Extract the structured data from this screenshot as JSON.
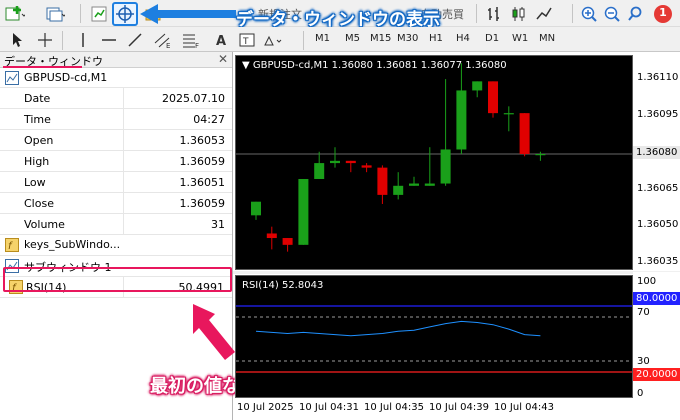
{
  "toolbar": {
    "new_order_label": "新規注文",
    "auto_trade_label": "自動売買",
    "timeframes": [
      "M1",
      "M5",
      "M15",
      "M30",
      "H1",
      "H4",
      "D1",
      "W1",
      "MN"
    ],
    "notification_count": "1"
  },
  "callout_top": "データ・ウィンドウの表示",
  "callout_bottom": "最初の値なので1番",
  "data_window": {
    "title": "データ・ウィンドウ",
    "symbol": "GBPUSD-cd,M1",
    "rows": [
      {
        "key": "Date",
        "value": "2025.07.10"
      },
      {
        "key": "Time",
        "value": "04:27"
      },
      {
        "key": "Open",
        "value": "1.36053"
      },
      {
        "key": "High",
        "value": "1.36059"
      },
      {
        "key": "Low",
        "value": "1.36051"
      },
      {
        "key": "Close",
        "value": "1.36059"
      },
      {
        "key": "Volume",
        "value": "31"
      }
    ],
    "indicator_name": "keys_SubWindo...",
    "subwindow_name": "サブウィンドウ 1",
    "rsi_key": "RSI(14)",
    "rsi_value": "50.4991"
  },
  "chart": {
    "info": "GBPUSD-cd,M1  1.36080  1.36081  1.36077  1.36080",
    "price_labels": [
      "1.36110",
      "1.36095",
      "1.36080",
      "1.36065",
      "1.36050",
      "1.36035"
    ],
    "current_price": "1.36080",
    "rsi_info": "RSI(14) 52.8043",
    "rsi_scale": [
      "100",
      "70",
      "30",
      "0"
    ],
    "rsi_level_high": "80.0000",
    "rsi_level_low": "20.0000",
    "time_labels": [
      "10 Jul 2025",
      "10 Jul 04:31",
      "10 Jul 04:35",
      "10 Jul 04:39",
      "10 Jul 04:43"
    ],
    "colors": {
      "bull": "#1aa01a",
      "bear": "#e00000",
      "rsi": "#1e90ff",
      "level_high": "#2222ff",
      "level_low": "#ff2020"
    }
  },
  "chart_data": {
    "type": "candlestick",
    "x": [
      "04:27",
      "04:28",
      "04:29",
      "04:30",
      "04:31",
      "04:32",
      "04:33",
      "04:34",
      "04:35",
      "04:36",
      "04:37",
      "04:38",
      "04:39",
      "04:40",
      "04:41",
      "04:42",
      "04:43",
      "04:44",
      "04:45"
    ],
    "open": [
      1.36053,
      1.36045,
      1.36043,
      1.3604,
      1.36069,
      1.36076,
      1.36077,
      1.36075,
      1.36074,
      1.36062,
      1.36066,
      1.36066,
      1.36067,
      1.36082,
      1.36108,
      1.36112,
      1.36098,
      1.36098,
      1.3608
    ],
    "high": [
      1.36059,
      1.36048,
      1.36043,
      1.36054,
      1.36081,
      1.36083,
      1.36077,
      1.36076,
      1.36075,
      1.36072,
      1.3607,
      1.36083,
      1.36113,
      1.3612,
      1.36112,
      1.36112,
      1.36101,
      1.36098,
      1.36081
    ],
    "low": [
      1.36051,
      1.36038,
      1.36037,
      1.3604,
      1.36069,
      1.36074,
      1.36072,
      1.36072,
      1.36058,
      1.3606,
      1.36066,
      1.36066,
      1.36066,
      1.3608,
      1.36105,
      1.36096,
      1.3609,
      1.36079,
      1.36077
    ],
    "close": [
      1.36059,
      1.36043,
      1.3604,
      1.36069,
      1.36076,
      1.36077,
      1.36076,
      1.36074,
      1.36062,
      1.36066,
      1.36067,
      1.36067,
      1.36082,
      1.36108,
      1.36112,
      1.36098,
      1.36098,
      1.3608,
      1.3608
    ],
    "ylim": [
      1.36032,
      1.36117
    ],
    "rsi": [
      57,
      56,
      55,
      56,
      55,
      54,
      53,
      54,
      55,
      57,
      58,
      61,
      64,
      66,
      65,
      63,
      59,
      54,
      53
    ],
    "rsi_ylim": [
      0,
      100
    ]
  }
}
